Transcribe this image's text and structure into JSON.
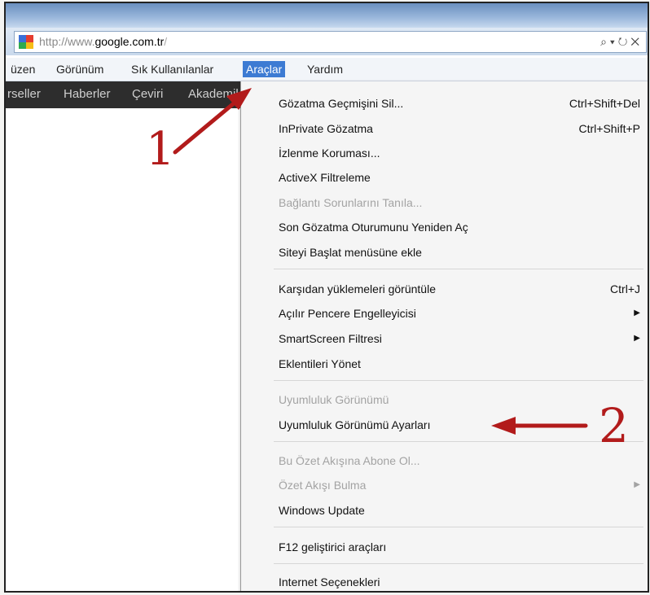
{
  "browser": {
    "url_prefix": "http://www.",
    "url_domain": "google.com.tr",
    "url_sep": "/",
    "addr_icons": "⌕ ▾ ↻ ✕"
  },
  "menubar": {
    "items": [
      {
        "label": "üzen"
      },
      {
        "label": "Görünüm"
      },
      {
        "label": "Sık Kullanılanlar"
      },
      {
        "label": "Araçlar"
      },
      {
        "label": "Yardım"
      }
    ]
  },
  "google_bar": {
    "links": [
      {
        "label": "rseller"
      },
      {
        "label": "Haberler"
      },
      {
        "label": "Çeviri"
      },
      {
        "label": "Akademik"
      }
    ]
  },
  "tools_menu": {
    "items": [
      {
        "label": "Gözatma Geçmişini Sil...",
        "shortcut": "Ctrl+Shift+Del"
      },
      {
        "label": "InPrivate Gözatma",
        "shortcut": "Ctrl+Shift+P"
      },
      {
        "label": "İzlenme Koruması..."
      },
      {
        "label": "ActiveX Filtreleme"
      },
      {
        "label": "Bağlantı Sorunlarını Tanıla...",
        "disabled": true
      },
      {
        "label": "Son Gözatma Oturumunu Yeniden Aç"
      },
      {
        "label": "Siteyi Başlat menüsüne ekle"
      },
      {
        "label": "Karşıdan yüklemeleri görüntüle",
        "shortcut": "Ctrl+J"
      },
      {
        "label": "Açılır Pencere Engelleyicisi",
        "submenu": true
      },
      {
        "label": "SmartScreen Filtresi",
        "submenu": true
      },
      {
        "label": "Eklentileri Yönet"
      },
      {
        "label": "Uyumluluk Görünümü",
        "disabled": true
      },
      {
        "label": "Uyumluluk Görünümü Ayarları"
      },
      {
        "label": "Bu Özet Akışına Abone Ol...",
        "disabled": true
      },
      {
        "label": "Özet Akışı Bulma",
        "disabled": true,
        "submenu": true
      },
      {
        "label": "Windows Update"
      },
      {
        "label": "F12 geliştirici araçları"
      },
      {
        "label": "Internet Seçenekleri"
      }
    ]
  },
  "annotations": {
    "step1": "1",
    "step2": "2",
    "color": "#b21b1b"
  }
}
